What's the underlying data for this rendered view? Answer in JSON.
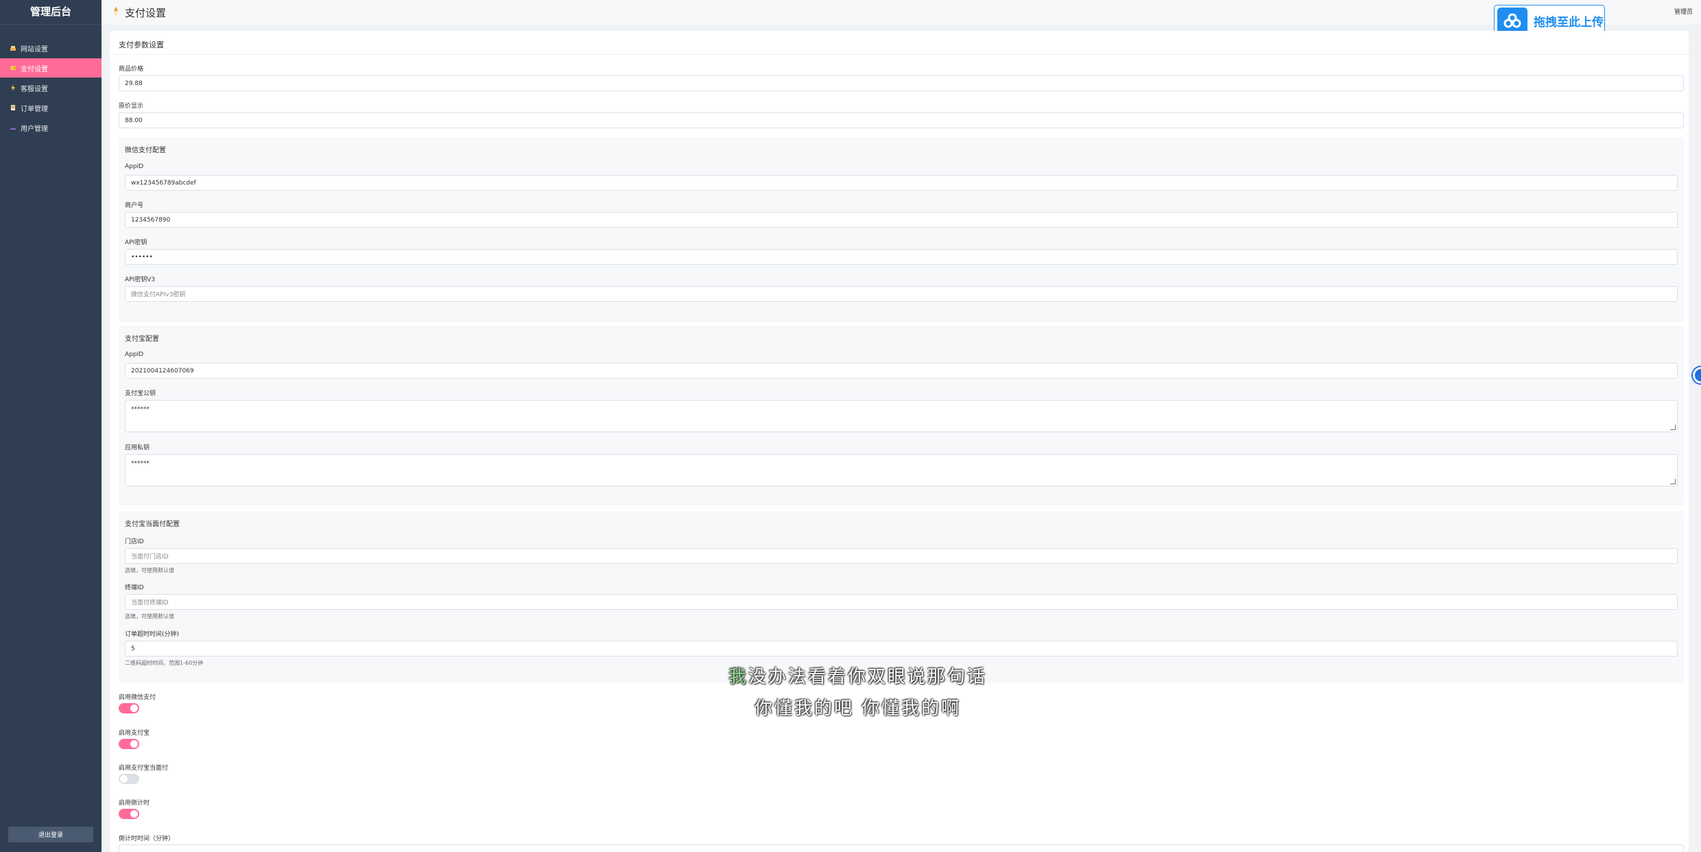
{
  "sidebar": {
    "brand": "管理后台",
    "items": [
      {
        "label": "网站设置",
        "icon": "cake-icon"
      },
      {
        "label": "支付设置",
        "icon": "wallet-icon"
      },
      {
        "label": "客服设置",
        "icon": "lightning-icon"
      },
      {
        "label": "订单管理",
        "icon": "document-icon"
      },
      {
        "label": "用户管理",
        "icon": "user-icon"
      }
    ],
    "active_index": 1,
    "logout_label": "退出登录"
  },
  "header": {
    "title": "支付设置",
    "user": "管理员",
    "upload_label": "拖拽至此上传"
  },
  "main": {
    "title": "支付参数设置",
    "price_label": "商品价格",
    "price_value": "29.88",
    "orig_price_label": "原价显示",
    "orig_price_value": "88.00"
  },
  "wechat": {
    "title": "微信支付配置",
    "appid_label": "AppID",
    "appid_value": "wx123456789abcdef",
    "mchid_label": "商户号",
    "mchid_value": "1234567890",
    "apikey_label": "API密钥",
    "apikey_value": "••••••",
    "apikey_v3_label": "API密钥V3",
    "apikey_v3_placeholder": "微信支付APIv3密钥"
  },
  "alipay": {
    "title": "支付宝配置",
    "appid_label": "AppID",
    "appid_value": "2021004124607069",
    "pubkey_label": "支付宝公钥",
    "pubkey_value": "******",
    "privkey_label": "应用私钥",
    "privkey_value": "******"
  },
  "face_pay": {
    "title": "支付宝当面付配置",
    "store_label": "门店ID",
    "store_placeholder": "当面付门店ID",
    "store_hint": "选填，可使用默认值",
    "terminal_label": "终端ID",
    "terminal_placeholder": "当面付终端ID",
    "terminal_hint": "选填，可使用默认值",
    "timeout_label": "订单超时时间(分钟)",
    "timeout_value": "5",
    "timeout_hint": "二维码超时时间，范围1-60分钟"
  },
  "toggles": [
    {
      "label": "启用微信支付",
      "on": true
    },
    {
      "label": "启用支付宝",
      "on": true
    },
    {
      "label": "启用支付宝当面付",
      "on": false
    },
    {
      "label": "启用倒计时",
      "on": true
    }
  ],
  "countdown_label": "倒计时时间（分钟）",
  "subtitle": {
    "line1_highlight": "我",
    "line1_rest": "没办法看着你双眼说那句话",
    "line2": "你懂我的吧 你懂我的啊"
  },
  "colors": {
    "sidebar": "#2f3e52",
    "accent": "#ff6b98",
    "upload_blue": "#1f8ef0"
  }
}
